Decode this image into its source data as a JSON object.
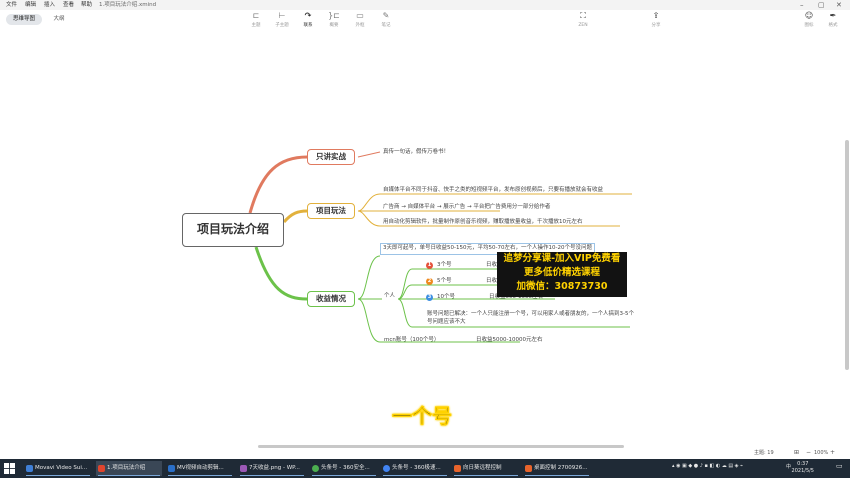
{
  "menubar": {
    "items": [
      "文件",
      "编辑",
      "插入",
      "查看",
      "帮助"
    ],
    "filename": "1.项目玩法介绍.xmind"
  },
  "tabs": [
    {
      "label": "思维导图"
    },
    {
      "label": "大纲"
    }
  ],
  "toolbar": {
    "tools": [
      {
        "label": "主题",
        "icon": "topic-icon"
      },
      {
        "label": "子主题",
        "icon": "subtopic-icon"
      },
      {
        "label": "联系",
        "icon": "relationship-icon"
      },
      {
        "label": "概要",
        "icon": "summary-icon"
      },
      {
        "label": "外框",
        "icon": "boundary-icon"
      },
      {
        "label": "笔记",
        "icon": "note-icon"
      }
    ],
    "zen_label": "ZEN",
    "share_label": "分享",
    "outline_label": "图标",
    "format_label": "格式"
  },
  "mindmap": {
    "root": "项目玩法介绍",
    "branches": [
      {
        "label": "只讲实战",
        "color": "#e07a5f",
        "leaves": [
          "真传一句话，假传万卷书！"
        ]
      },
      {
        "label": "项目玩法",
        "color": "#e2b13c",
        "leaves": [
          "自媒体平台不同于抖音、快手之类的短视频平台，发布原创视频后，只要有播放就会有收益",
          "广告商 → 自媒体平台 → 展示广告 → 平台把广告费用分一部分给作者",
          "用自动化剪辑软件，批量制作原创音乐视频，赚取播放量收益，千次播放10元左右"
        ]
      },
      {
        "label": "收益情况",
        "color": "#6cc24a",
        "top_leaf": "3天即可起号，单号日收益50-150元，平均50-70左右，一个人操作10-20个号没问题",
        "person_label": "个人",
        "person_items": [
          {
            "num": "1",
            "label": "3个号",
            "income": "日收",
            "color": "#e5533d"
          },
          {
            "num": "2",
            "label": "5个号",
            "income": "日收",
            "color": "#ef8a1f"
          },
          {
            "num": "3",
            "label": "10个号",
            "income": "日收益500-1500左右",
            "color": "#3d8fe0"
          }
        ],
        "account_note": "账号问题已解决：一个人只能注册一个号，可以用家人或者朋友的，一个人搞到3-5个号问题应该不大",
        "mcn_label": "mcn账号（100个号）",
        "mcn_income": "日收益5000-10000元左右"
      }
    ]
  },
  "promo": {
    "line1": "追梦分享课-加入VIP免费看",
    "line2": "更多低价精选课程",
    "line3": "加微信：30873730"
  },
  "caption": "一个号",
  "status": {
    "topic_count": "主题: 19",
    "zoom": "100%"
  },
  "taskbar": {
    "items": [
      {
        "label": "Movavi Video Sui...",
        "color": "#3f7fd6"
      },
      {
        "label": "1.项目玩法介绍",
        "color": "#e0452e",
        "active": true
      },
      {
        "label": "MV视频自动剪辑...",
        "color": "#2a6fc9"
      },
      {
        "label": "7天收益.png - WP...",
        "color": "#9b59b6"
      },
      {
        "label": "头条号 - 360安全...",
        "color": "#4caf50"
      },
      {
        "label": "头条号 - 360极速...",
        "color": "#4285f4"
      },
      {
        "label": "向日葵远程控制",
        "color": "#e8642c"
      },
      {
        "label": "桌面控制 2700926...",
        "color": "#e8642c"
      }
    ],
    "time": "0:37",
    "date": "2021/5/5",
    "ime": "中"
  }
}
